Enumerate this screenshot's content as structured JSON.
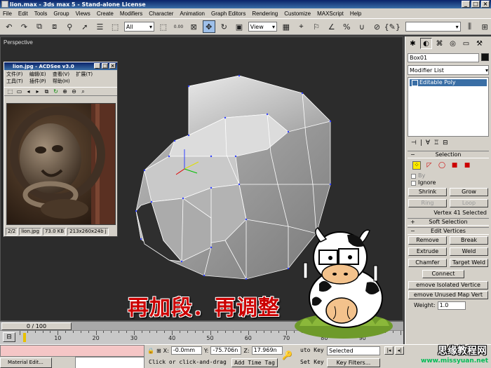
{
  "window": {
    "title": "lion.max - 3ds max 5 - Stand-alone License"
  },
  "menu": [
    "File",
    "Edit",
    "Tools",
    "Group",
    "Views",
    "Create",
    "Modifiers",
    "Character",
    "Animation",
    "Graph Editors",
    "Rendering",
    "Customize",
    "MAXScript",
    "Help"
  ],
  "toolbar": {
    "filter_select": "All",
    "view_select": "View",
    "spinner_value": "0.00"
  },
  "viewport": {
    "label": "Perspective"
  },
  "acdsee": {
    "title": "lion.jpg - ACDSee v3.0",
    "menu_row1": [
      "文件(F)",
      "编辑(E)",
      "查看(V)",
      "扩展(T)"
    ],
    "menu_row2": [
      "工具(T)",
      "插件(P)",
      "帮助(H)"
    ],
    "status": {
      "page": "2/2",
      "file": "lion.jpg",
      "size": "73.0 KB",
      "dims": "213x260x24b j"
    }
  },
  "command_panel": {
    "object_name": "Box01",
    "modifier_list": "Modifier List",
    "stack_items": [
      "Editable Poly"
    ],
    "selection": {
      "title": "Selection",
      "by_label": "By",
      "ignore_label": "Ignore",
      "shrink": "Shrink",
      "grow": "Grow",
      "ring": "Ring",
      "loop": "Loop",
      "status": "Vertex 41 Selected"
    },
    "soft_selection": "Soft Selection",
    "edit_vertices": {
      "title": "Edit Vertices",
      "remove": "Remove",
      "break": "Break",
      "extrude": "Extrude",
      "weld": "Weld",
      "chamfer": "Chamfer",
      "target_weld": "Target Weld",
      "connect": "Connect",
      "remove_isolated": "emove Isolated Vertice",
      "remove_unused": "emove Unused Map Vert",
      "weight_label": "Weight:",
      "weight_value": "1.0"
    }
  },
  "timeline": {
    "slider_text": "0 / 100",
    "ticks": [
      "10",
      "20",
      "30",
      "40",
      "50",
      "60",
      "70",
      "80",
      "90"
    ]
  },
  "statusbar": {
    "task": "Material Edit...",
    "x_label": "X:",
    "x_value": "-0.0mm",
    "y_label": "Y:",
    "y_value": "-75.706n",
    "z_label": "Z:",
    "z_value": "17.969n",
    "prompt": "Click or click-and-drag",
    "add_time_tag": "Add Time Tag",
    "auto_key": "uto Key",
    "set_key": "Set Key",
    "selected_drop": "Selected",
    "key_filters": "Key Filters..."
  },
  "overlay": {
    "caption": "再加段．再调整",
    "watermark_main": "思缘教程网",
    "watermark_url": "www.missyuan.net"
  }
}
